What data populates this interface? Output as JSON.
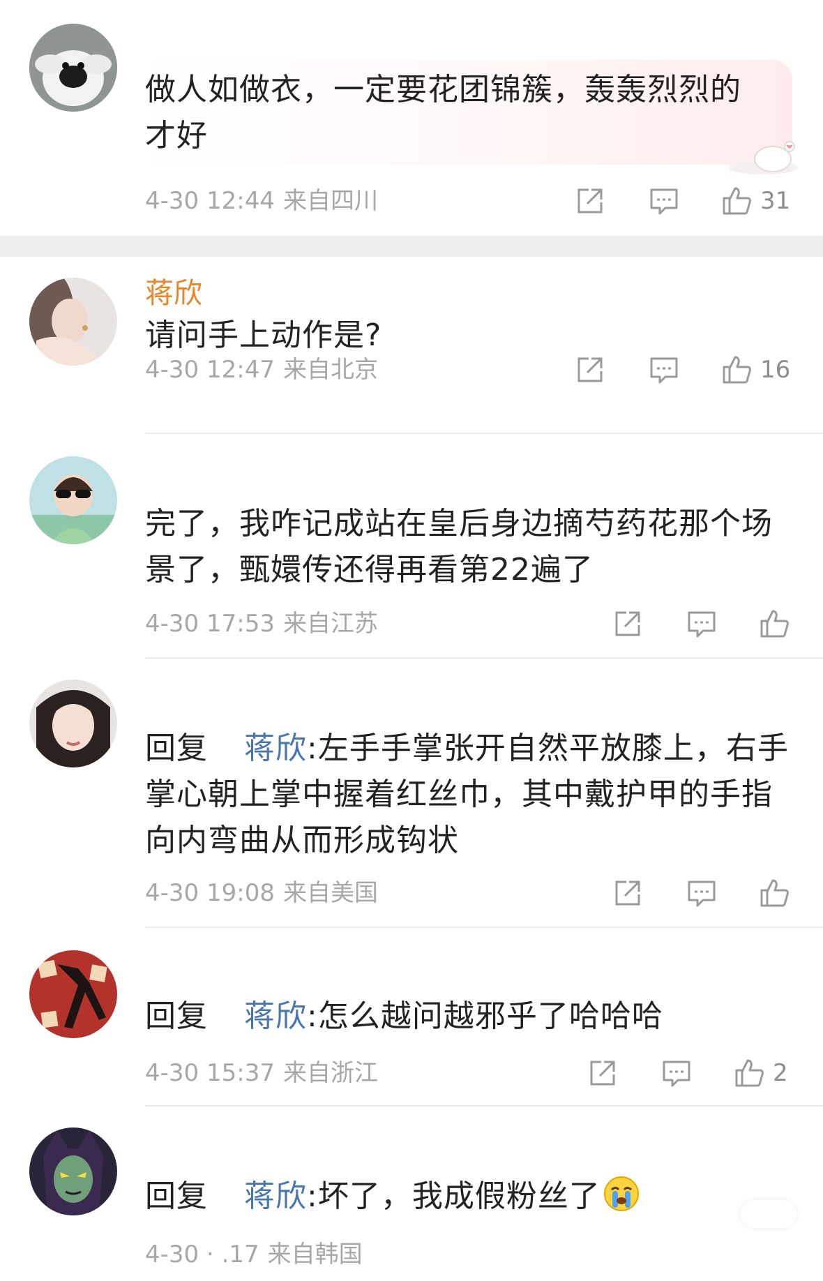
{
  "comments": [
    {
      "text": "做人如做衣，一定要花团锦簇，轰轰烈烈的才好",
      "time": "4-30 12:44",
      "location": "来自四川",
      "likes": "31"
    },
    {
      "username": "蒋欣",
      "text": "请问手上动作是?",
      "time": "4-30 12:47",
      "location": "来自北京",
      "likes": "16"
    },
    {
      "text": "完了，我咋记成站在皇后身边摘芍药花那个场景了，甄嬛传还得再看第22遍了",
      "time": "4-30 17:53",
      "location": "来自江苏"
    },
    {
      "reply_keyword": "回复",
      "mention": "蒋欣",
      "text": ":左手手掌张开自然平放膝上，右手掌心朝上掌中握着红丝巾，其中戴护甲的手指向内弯曲从而形成钩状",
      "time": "4-30 19:08",
      "location": "来自美国"
    },
    {
      "reply_keyword": "回复",
      "mention": "蒋欣",
      "text": ":怎么越问越邪乎了哈哈哈",
      "time": "4-30 15:37",
      "location": "来自浙江",
      "likes": "2"
    },
    {
      "reply_keyword": "回复",
      "mention": "蒋欣",
      "text": ":坏了，我成假粉丝了",
      "time": "4-30 ⋅ .17",
      "location": "来自韩国"
    }
  ],
  "icons": {
    "share": "share-icon",
    "comment": "comment-icon",
    "like": "like-icon",
    "emoji": "crying-face-emoji"
  },
  "colors": {
    "username": "#e8862a",
    "mention": "#4a76ad",
    "meta": "#a7a7a7"
  }
}
